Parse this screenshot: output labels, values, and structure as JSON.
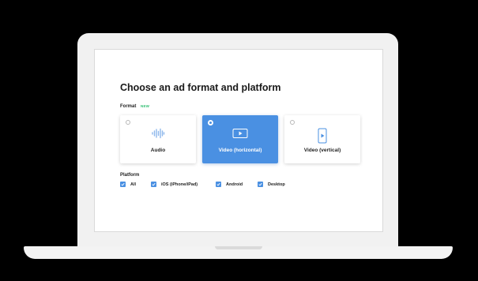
{
  "page": {
    "title": "Choose an ad format and platform"
  },
  "format": {
    "label": "Format",
    "badge": "NEW",
    "options": [
      {
        "label": "Audio",
        "icon": "audio-waveform-icon",
        "selected": false
      },
      {
        "label": "Video (horizontal)",
        "icon": "video-horizontal-icon",
        "selected": true
      },
      {
        "label": "Video (vertical)",
        "icon": "video-vertical-icon",
        "selected": false
      }
    ]
  },
  "platform": {
    "label": "Platform",
    "options": [
      {
        "label": "All",
        "checked": true
      },
      {
        "label": "iOS (iPhone/iPad)",
        "checked": true
      },
      {
        "label": "Android",
        "checked": true
      },
      {
        "label": "Desktop",
        "checked": true
      }
    ]
  },
  "colors": {
    "accent": "#4a90e2",
    "new_badge": "#2fbf71",
    "background": "#000000",
    "laptop_body": "#f1f1f1"
  }
}
